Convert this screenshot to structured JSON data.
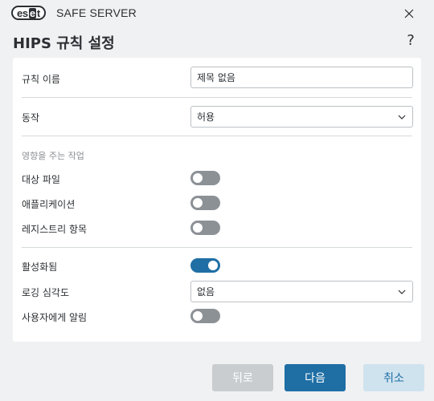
{
  "window": {
    "logo_parts": [
      "es",
      "e",
      "t"
    ],
    "product_name": "SAFE SERVER",
    "title": "HIPS 규칙 설정",
    "help_label": "?"
  },
  "form": {
    "rule_name_label": "규칙 이름",
    "rule_name_value": "제목 없음",
    "action_label": "동작",
    "action_value": "허용",
    "affected_section": "영향을 주는 작업",
    "target_files_label": "대상 파일",
    "target_files_on": false,
    "applications_label": "애플리케이션",
    "applications_on": false,
    "registry_label": "레지스트리 항목",
    "registry_on": false,
    "enabled_label": "활성화됨",
    "enabled_on": true,
    "log_severity_label": "로깅 심각도",
    "log_severity_value": "없음",
    "notify_user_label": "사용자에게 알림",
    "notify_user_on": false
  },
  "footer": {
    "back_label": "뒤로",
    "next_label": "다음",
    "cancel_label": "취소"
  },
  "colors": {
    "accent": "#1f6fa5",
    "toggle_off": "#8c9196",
    "background": "#f0f1f2"
  }
}
